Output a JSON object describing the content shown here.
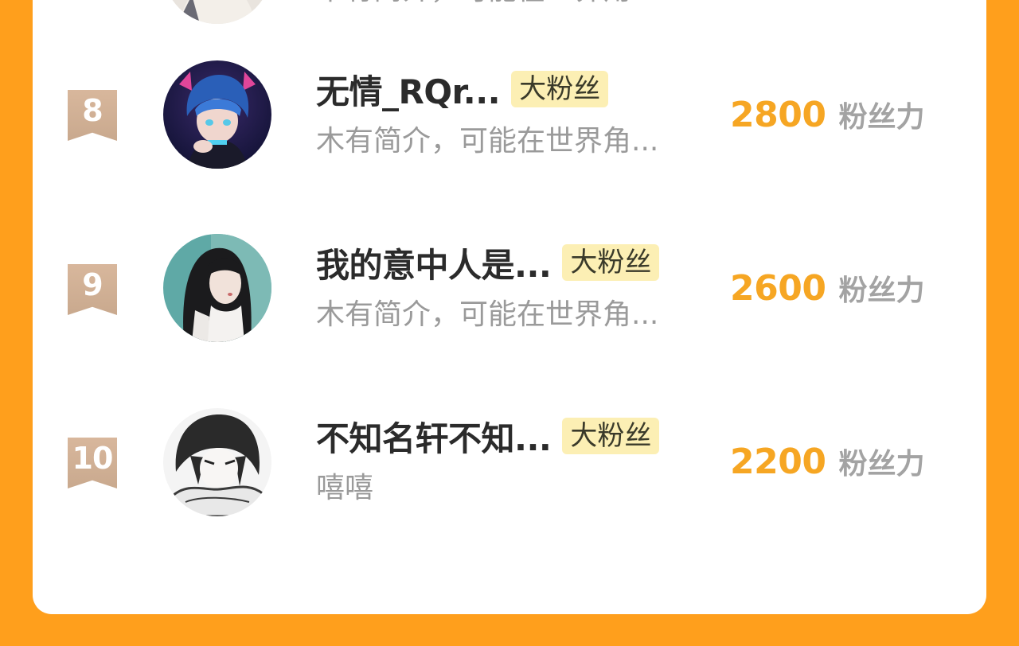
{
  "prev_row": {
    "desc": "木有简介，可能在世界角..."
  },
  "rows": [
    {
      "rank": "8",
      "name": "无情_RQr...",
      "badge": "大粉丝",
      "desc": "木有简介，可能在世界角...",
      "power": "2800",
      "power_unit": "粉丝力"
    },
    {
      "rank": "9",
      "name": "我的意中人是...",
      "badge": "大粉丝",
      "desc": "木有简介，可能在世界角...",
      "power": "2600",
      "power_unit": "粉丝力"
    },
    {
      "rank": "10",
      "name": "不知名轩不知...",
      "badge": "大粉丝",
      "desc": "嘻嘻",
      "power": "2200",
      "power_unit": "粉丝力"
    }
  ],
  "colors": {
    "background": "#ff9f1c",
    "card": "#ffffff",
    "rank_badge": "#d4b398",
    "fan_badge": "#fcefb4",
    "power_number": "#f6a623",
    "name": "#2b2b2b",
    "desc": "#9a9a9a"
  }
}
